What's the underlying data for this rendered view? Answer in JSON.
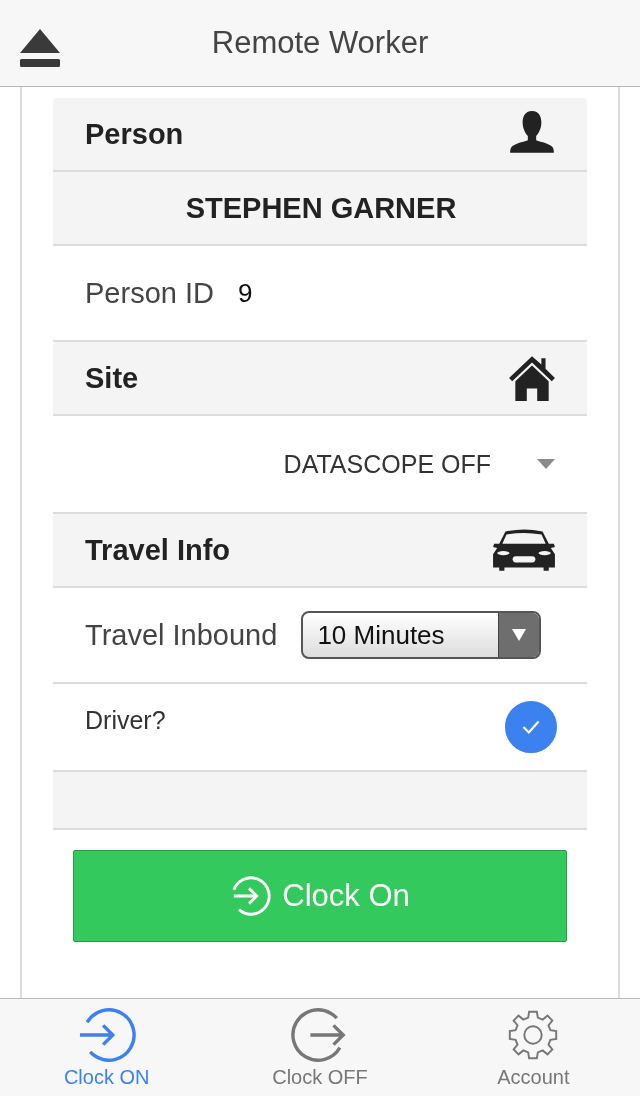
{
  "header": {
    "title": "Remote Worker"
  },
  "sections": [
    {
      "kind": "header",
      "title": "Person"
    },
    {
      "kind": "name",
      "text": "STEPHEN GARNER"
    },
    {
      "kind": "field",
      "label": "Person ID",
      "value": "9"
    },
    {
      "kind": "header",
      "title": "Site"
    },
    {
      "kind": "select",
      "value": "DATASCOPE OFF"
    },
    {
      "kind": "header",
      "title": "Travel Info"
    },
    {
      "kind": "dropdown",
      "label": "Travel Inbound",
      "value": "10 Minutes"
    },
    {
      "kind": "check",
      "label": "Driver?",
      "checked": true
    },
    {
      "kind": "blank"
    }
  ],
  "action": {
    "label": "Clock On"
  },
  "tabs": [
    {
      "label": "Clock ON",
      "selected": true
    },
    {
      "label": "Clock OFF",
      "selected": false
    },
    {
      "label": "Account",
      "selected": false
    }
  ]
}
